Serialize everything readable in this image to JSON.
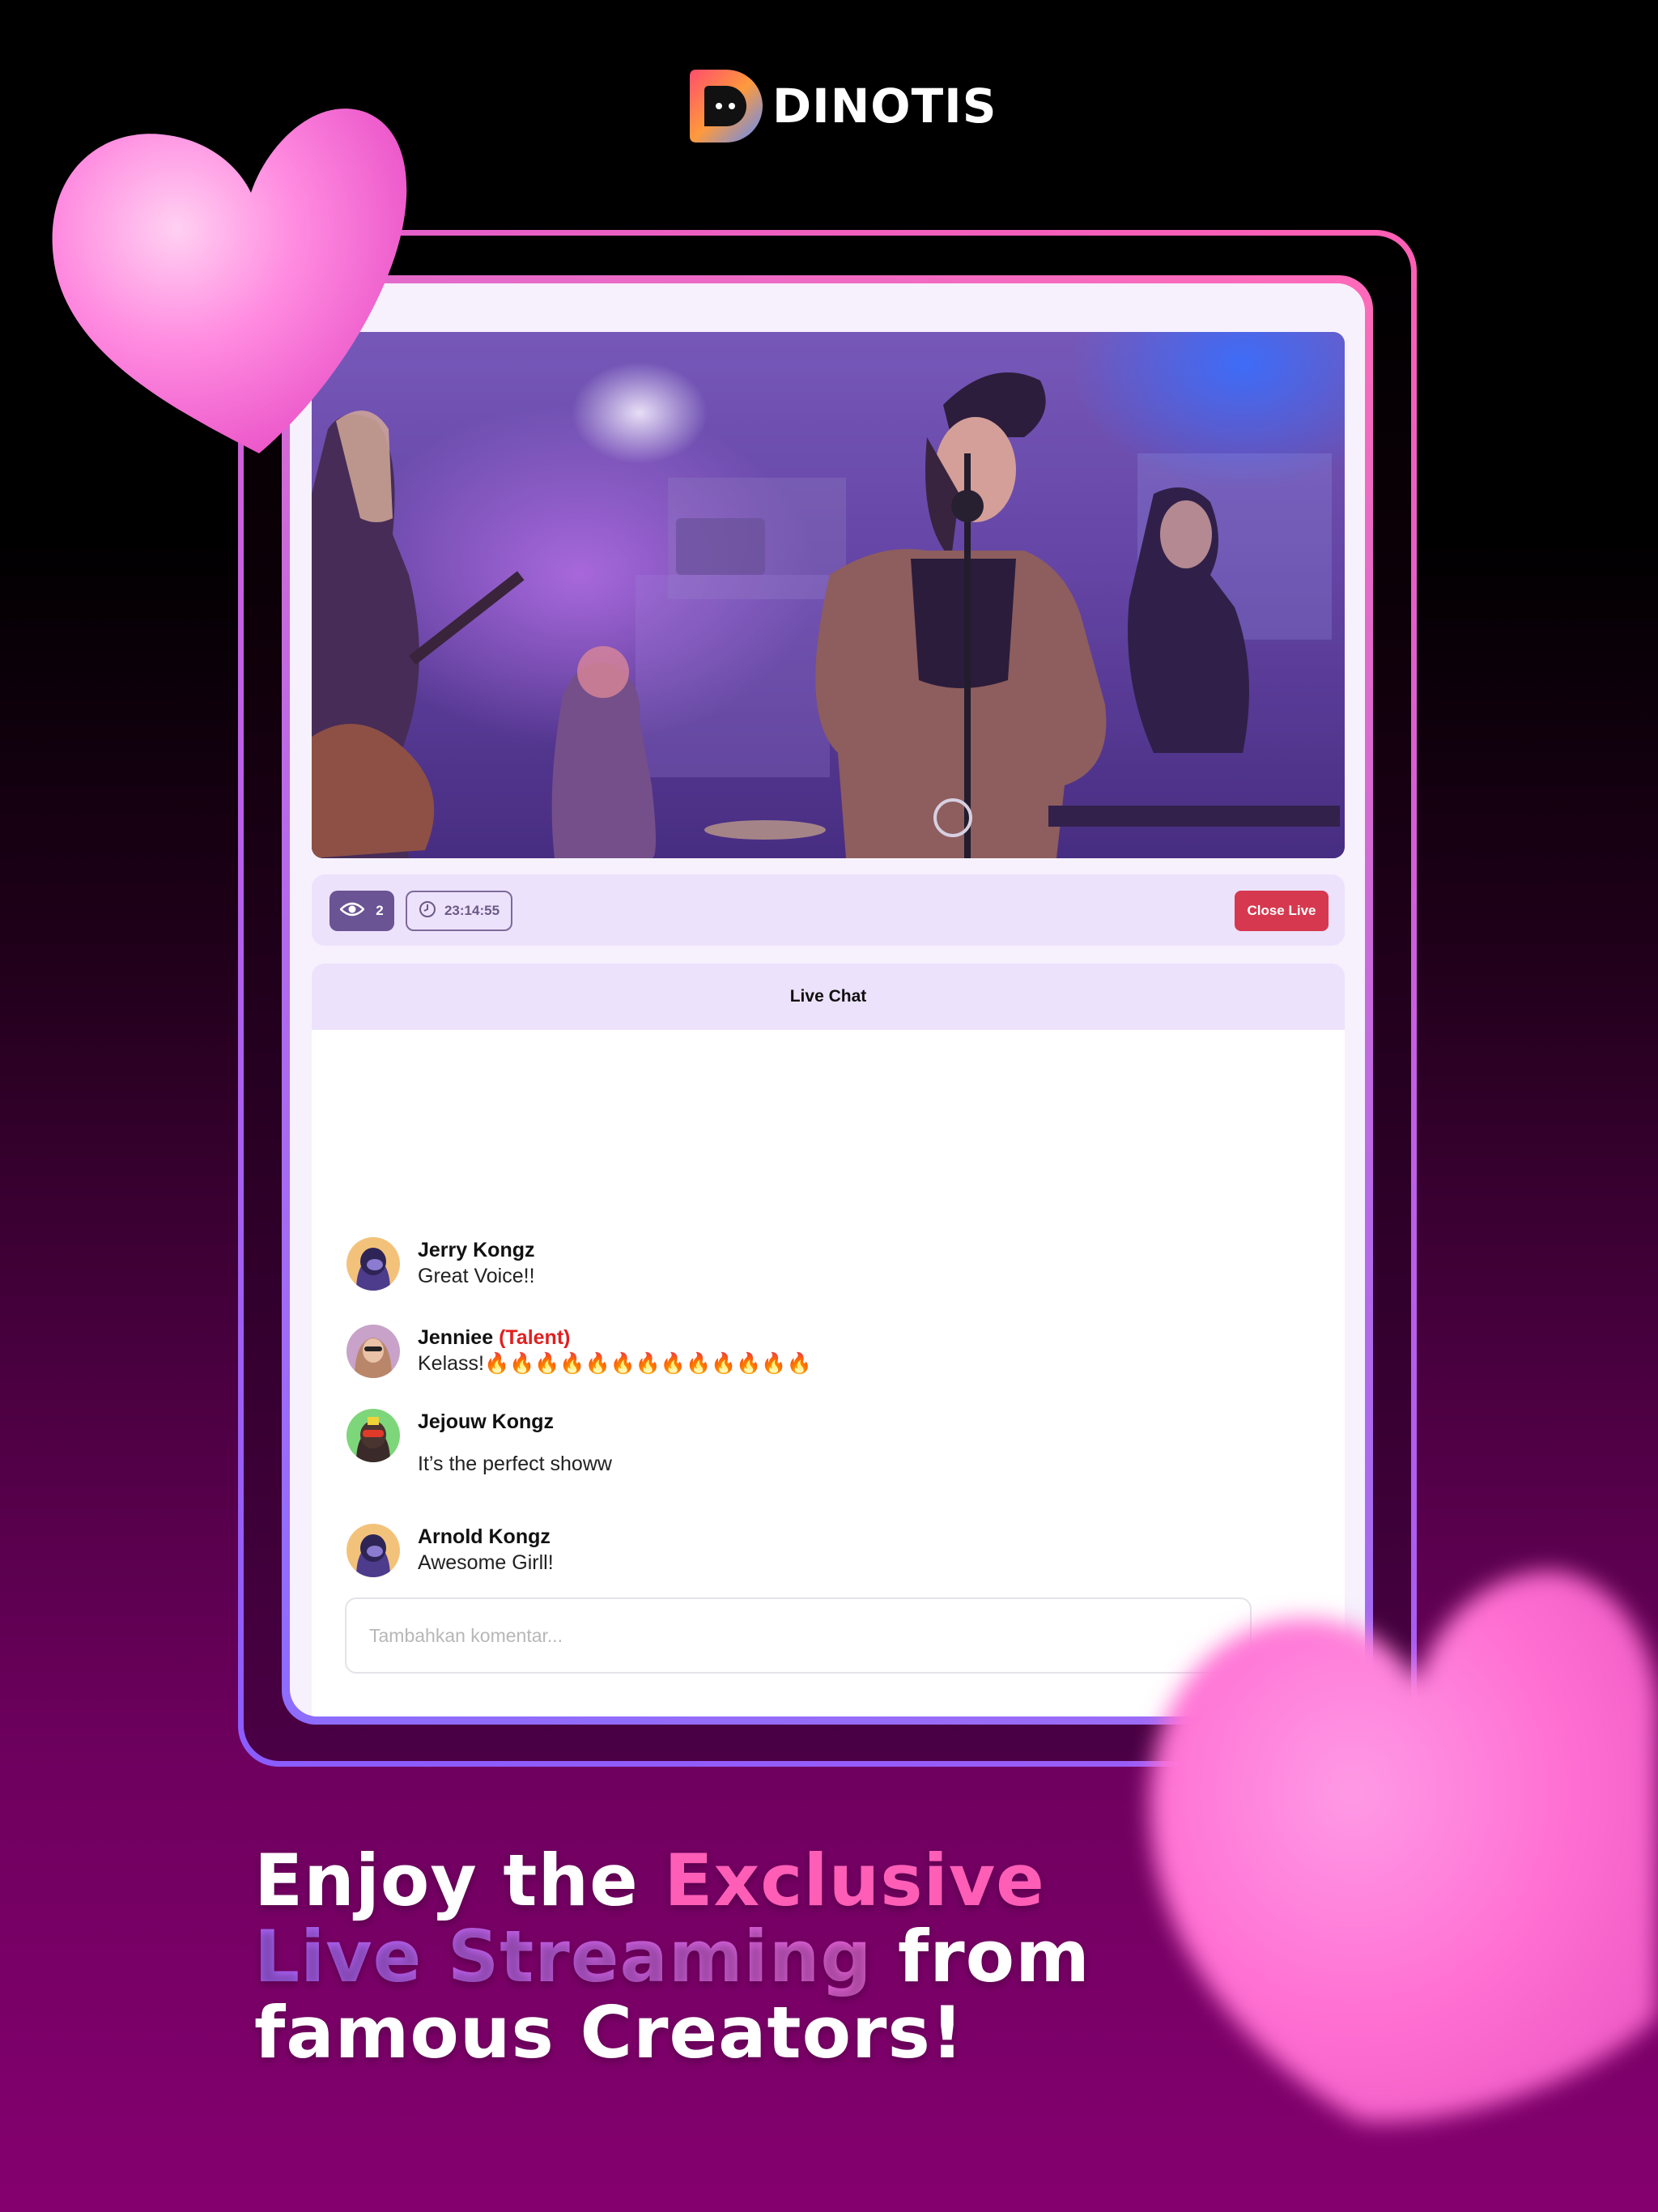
{
  "brand": {
    "name": "DINOTIS"
  },
  "stream": {
    "viewer_count": "2",
    "elapsed_time": "23:14:55",
    "close_label": "Close Live"
  },
  "chat": {
    "title": "Live Chat",
    "messages": [
      {
        "name": "Jerry Kongz",
        "badge": "",
        "text": "Great Voice!!"
      },
      {
        "name": "Jenniee",
        "badge": "(Talent)",
        "text": "Kelass!🔥🔥🔥🔥🔥🔥🔥🔥🔥🔥🔥🔥🔥"
      },
      {
        "name": "Jejouw Kongz",
        "badge": "",
        "text": "It’s the perfect showw"
      },
      {
        "name": "Arnold Kongz",
        "badge": "",
        "text": "Awesome Girll!"
      }
    ],
    "input_placeholder": "Tambahkan komentar..."
  },
  "headline": {
    "part1": "Enjoy the ",
    "part2": "Exclusive",
    "part3": "Live Streaming",
    "part4": " from",
    "part5": "famous Creators!"
  },
  "colors": {
    "accent_pink": "#ff5eb6",
    "accent_purple": "#8a5cff",
    "close_button": "#d6394f",
    "talent_label": "#e0201f"
  }
}
